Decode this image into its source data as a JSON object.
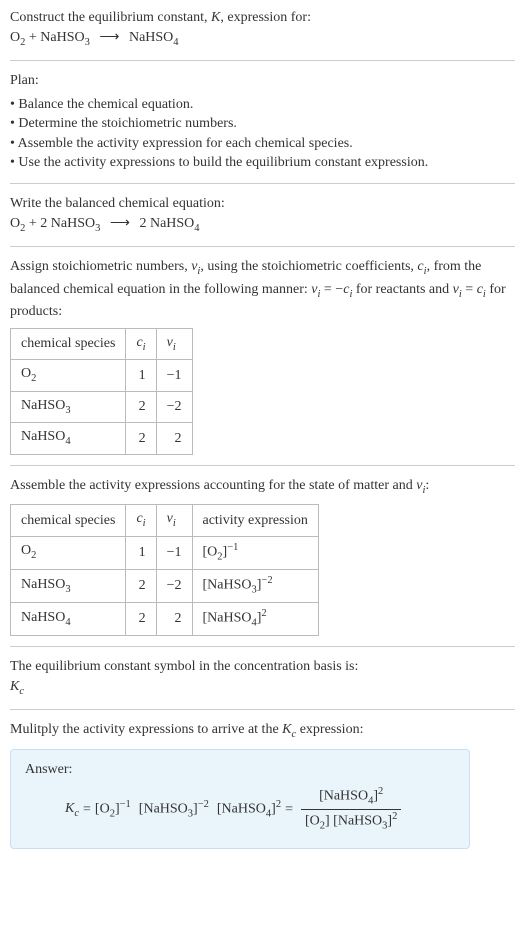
{
  "header": {
    "line1_a": "Construct the equilibrium constant, ",
    "line1_K": "K",
    "line1_b": ", expression for:",
    "eq_left_1": "O",
    "eq_left_1_sub": "2",
    "eq_plus": " + ",
    "eq_left_2": "NaHSO",
    "eq_left_2_sub": "3",
    "eq_arrow": "⟶",
    "eq_right_1": "NaHSO",
    "eq_right_1_sub": "4"
  },
  "plan": {
    "title": "Plan:",
    "items": [
      "Balance the chemical equation.",
      "Determine the stoichiometric numbers.",
      "Assemble the activity expression for each chemical species.",
      "Use the activity expressions to build the equilibrium constant expression."
    ]
  },
  "balanced": {
    "title": "Write the balanced chemical equation:",
    "l1": "O",
    "l1s": "2",
    "plus1": " + 2 ",
    "l2": "NaHSO",
    "l2s": "3",
    "arrow": "⟶",
    "r_coef": " 2 ",
    "r1": "NaHSO",
    "r1s": "4"
  },
  "stoich": {
    "intro_a": "Assign stoichiometric numbers, ",
    "nu": "ν",
    "nu_sub": "i",
    "intro_b": ", using the stoichiometric coefficients, ",
    "c": "c",
    "c_sub": "i",
    "intro_c": ", from the balanced chemical equation in the following manner: ",
    "rel1_a": "ν",
    "rel1_as": "i",
    "rel1_eq": " = −",
    "rel1_b": "c",
    "rel1_bs": "i",
    "intro_d": " for reactants and ",
    "rel2_a": "ν",
    "rel2_as": "i",
    "rel2_eq": " = ",
    "rel2_b": "c",
    "rel2_bs": "i",
    "intro_e": " for products:",
    "table": {
      "h1": "chemical species",
      "h2_a": "c",
      "h2_b": "i",
      "h3_a": "ν",
      "h3_b": "i",
      "rows": [
        {
          "sp_a": "O",
          "sp_b": "2",
          "c": "1",
          "v": "−1"
        },
        {
          "sp_a": "NaHSO",
          "sp_b": "3",
          "c": "2",
          "v": "−2"
        },
        {
          "sp_a": "NaHSO",
          "sp_b": "4",
          "c": "2",
          "v": "2"
        }
      ]
    }
  },
  "activity": {
    "intro_a": "Assemble the activity expressions accounting for the state of matter and ",
    "nu": "ν",
    "nu_sub": "i",
    "intro_b": ":",
    "table": {
      "h1": "chemical species",
      "h2_a": "c",
      "h2_b": "i",
      "h3_a": "ν",
      "h3_b": "i",
      "h4": "activity expression",
      "rows": [
        {
          "sp_a": "O",
          "sp_b": "2",
          "c": "1",
          "v": "−1",
          "ax_a": "[O",
          "ax_b": "2",
          "ax_c": "]",
          "ax_exp": "−1"
        },
        {
          "sp_a": "NaHSO",
          "sp_b": "3",
          "c": "2",
          "v": "−2",
          "ax_a": "[NaHSO",
          "ax_b": "3",
          "ax_c": "]",
          "ax_exp": "−2"
        },
        {
          "sp_a": "NaHSO",
          "sp_b": "4",
          "c": "2",
          "v": "2",
          "ax_a": "[NaHSO",
          "ax_b": "4",
          "ax_c": "]",
          "ax_exp": "2"
        }
      ]
    }
  },
  "symbol": {
    "line1": "The equilibrium constant symbol in the concentration basis is:",
    "K": "K",
    "Ksub": "c"
  },
  "multiply": {
    "a": "Mulitply the activity expressions to arrive at the ",
    "K": "K",
    "Ksub": "c",
    "b": " expression:"
  },
  "answer": {
    "label": "Answer:",
    "K": "K",
    "Ksub": "c",
    "eq": " = ",
    "t1_a": "[O",
    "t1_b": "2",
    "t1_c": "]",
    "t1_exp": "−1",
    "sp": " ",
    "t2_a": "[NaHSO",
    "t2_b": "3",
    "t2_c": "]",
    "t2_exp": "−2",
    "t3_a": "[NaHSO",
    "t3_b": "4",
    "t3_c": "]",
    "t3_exp": "2",
    "eq2": " = ",
    "num_a": "[NaHSO",
    "num_b": "4",
    "num_c": "]",
    "num_exp": "2",
    "den1_a": "[O",
    "den1_b": "2",
    "den1_c": "] ",
    "den2_a": "[NaHSO",
    "den2_b": "3",
    "den2_c": "]",
    "den2_exp": "2"
  }
}
